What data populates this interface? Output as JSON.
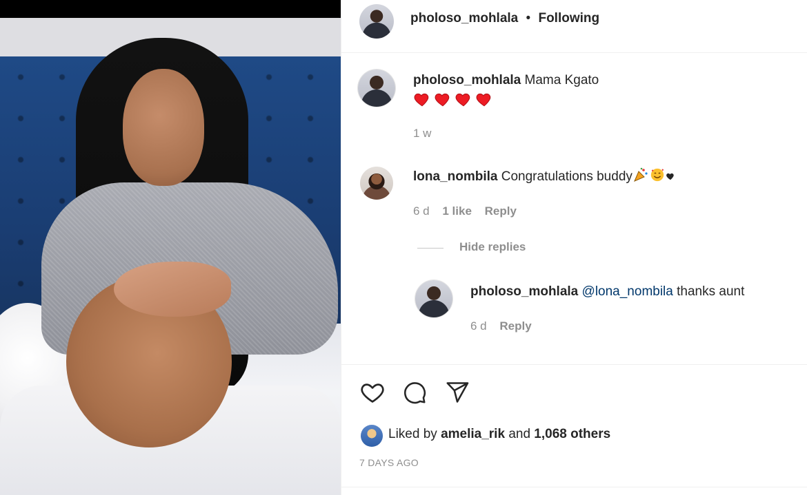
{
  "header": {
    "username": "pholoso_mohlala",
    "separator": "•",
    "follow_status": "Following"
  },
  "caption": {
    "username": "pholoso_mohlala",
    "text": "Mama Kgato",
    "emojis": "❤❤❤❤",
    "time": "1 w"
  },
  "comments": [
    {
      "username": "lona_nombila",
      "text": "Congratulations buddy",
      "emojis": "🎉🥰♥",
      "time": "6 d",
      "likes": "1 like",
      "reply_label": "Reply"
    }
  ],
  "replies_toggle": "Hide replies",
  "replies": [
    {
      "username": "pholoso_mohlala",
      "mention": "@lona_nombila",
      "text": "thanks aunt",
      "time": "6 d",
      "reply_label": "Reply"
    }
  ],
  "likes_summary": {
    "prefix": "Liked by",
    "liker": "amelia_rik",
    "joiner": "and",
    "others": "1,068 others"
  },
  "post_date": "7 DAYS AGO",
  "icons": [
    "heart-icon",
    "comment-icon",
    "share-icon"
  ],
  "colors": {
    "text": "#262626",
    "muted": "#8e8e8e",
    "mention": "#00376b",
    "heart_red": "#ed1c24"
  }
}
